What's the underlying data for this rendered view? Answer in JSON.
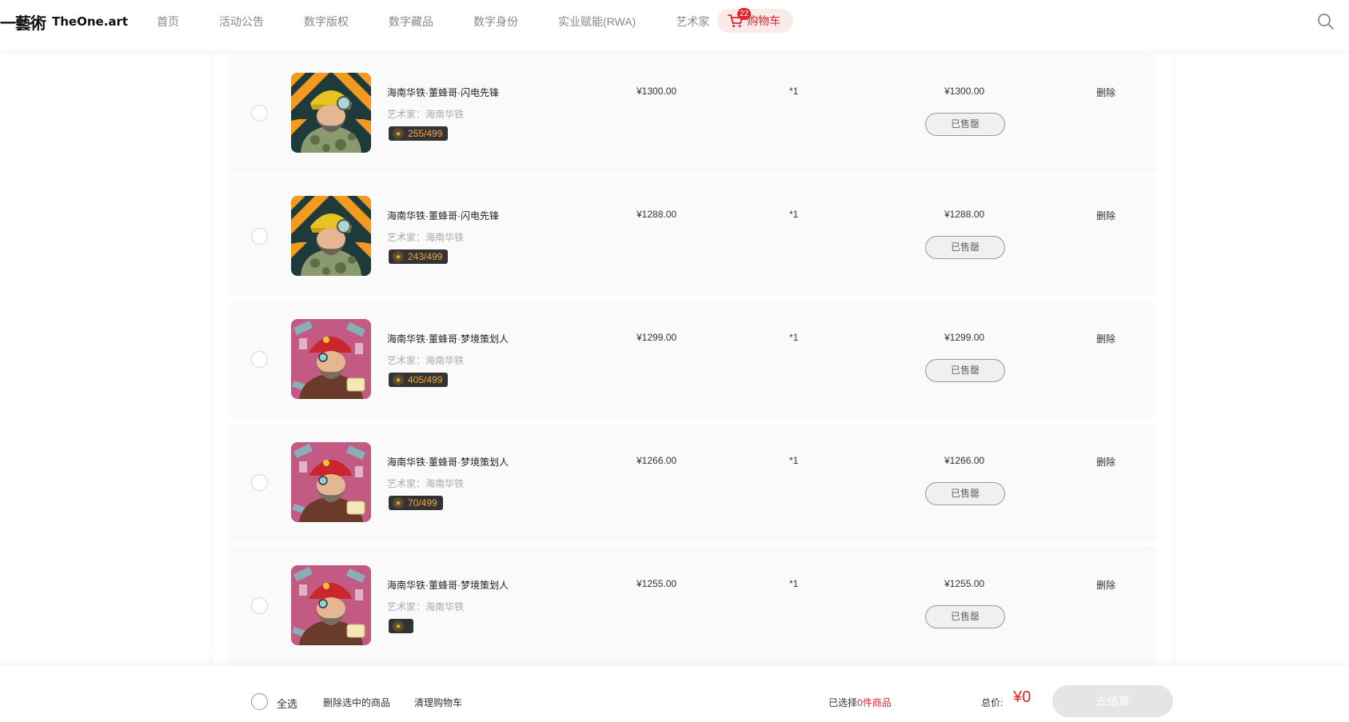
{
  "header": {
    "logo_cn": "一藝術",
    "logo_en": "TheOne.art",
    "nav": [
      "首页",
      "活动公告",
      "数字版权",
      "数字藏品",
      "数字身份",
      "实业赋能(RWA)",
      "艺术家"
    ],
    "cart_label": "购物车",
    "cart_count": "22"
  },
  "items": [
    {
      "name": "海南华铁·董蜂哥·闪电先锋",
      "artist": "艺术家：海南华铁",
      "edition": "255/499",
      "price": "¥1300.00",
      "qty": "*1",
      "subtotal": "¥1300.00",
      "status": "已售罄",
      "delete": "删除",
      "art": "yellow"
    },
    {
      "name": "海南华铁·董蜂哥·闪电先锋",
      "artist": "艺术家：海南华铁",
      "edition": "243/499",
      "price": "¥1288.00",
      "qty": "*1",
      "subtotal": "¥1288.00",
      "status": "已售罄",
      "delete": "删除",
      "art": "yellow"
    },
    {
      "name": "海南华铁·董蜂哥·梦境策划人",
      "artist": "艺术家：海南华铁",
      "edition": "405/499",
      "price": "¥1299.00",
      "qty": "*1",
      "subtotal": "¥1299.00",
      "status": "已售罄",
      "delete": "删除",
      "art": "red"
    },
    {
      "name": "海南华铁·董蜂哥·梦境策划人",
      "artist": "艺术家：海南华铁",
      "edition": "70/499",
      "price": "¥1266.00",
      "qty": "*1",
      "subtotal": "¥1266.00",
      "status": "已售罄",
      "delete": "删除",
      "art": "red"
    },
    {
      "name": "海南华铁·董蜂哥·梦境策划人",
      "artist": "艺术家：海南华铁",
      "edition": "",
      "price": "¥1255.00",
      "qty": "*1",
      "subtotal": "¥1255.00",
      "status": "已售罄",
      "delete": "删除",
      "art": "red"
    }
  ],
  "footer": {
    "select_all": "全选",
    "delete_selected": "删除选中的商品",
    "clear_cart": "清理购物车",
    "selected_prefix": "已选择",
    "selected_count": "0件商品",
    "total_label": "总价:",
    "total_amount": "¥0",
    "checkout": "去结算"
  },
  "colors": {
    "accent_red": "#e0232a",
    "edition_orange": "#f4a83a"
  }
}
